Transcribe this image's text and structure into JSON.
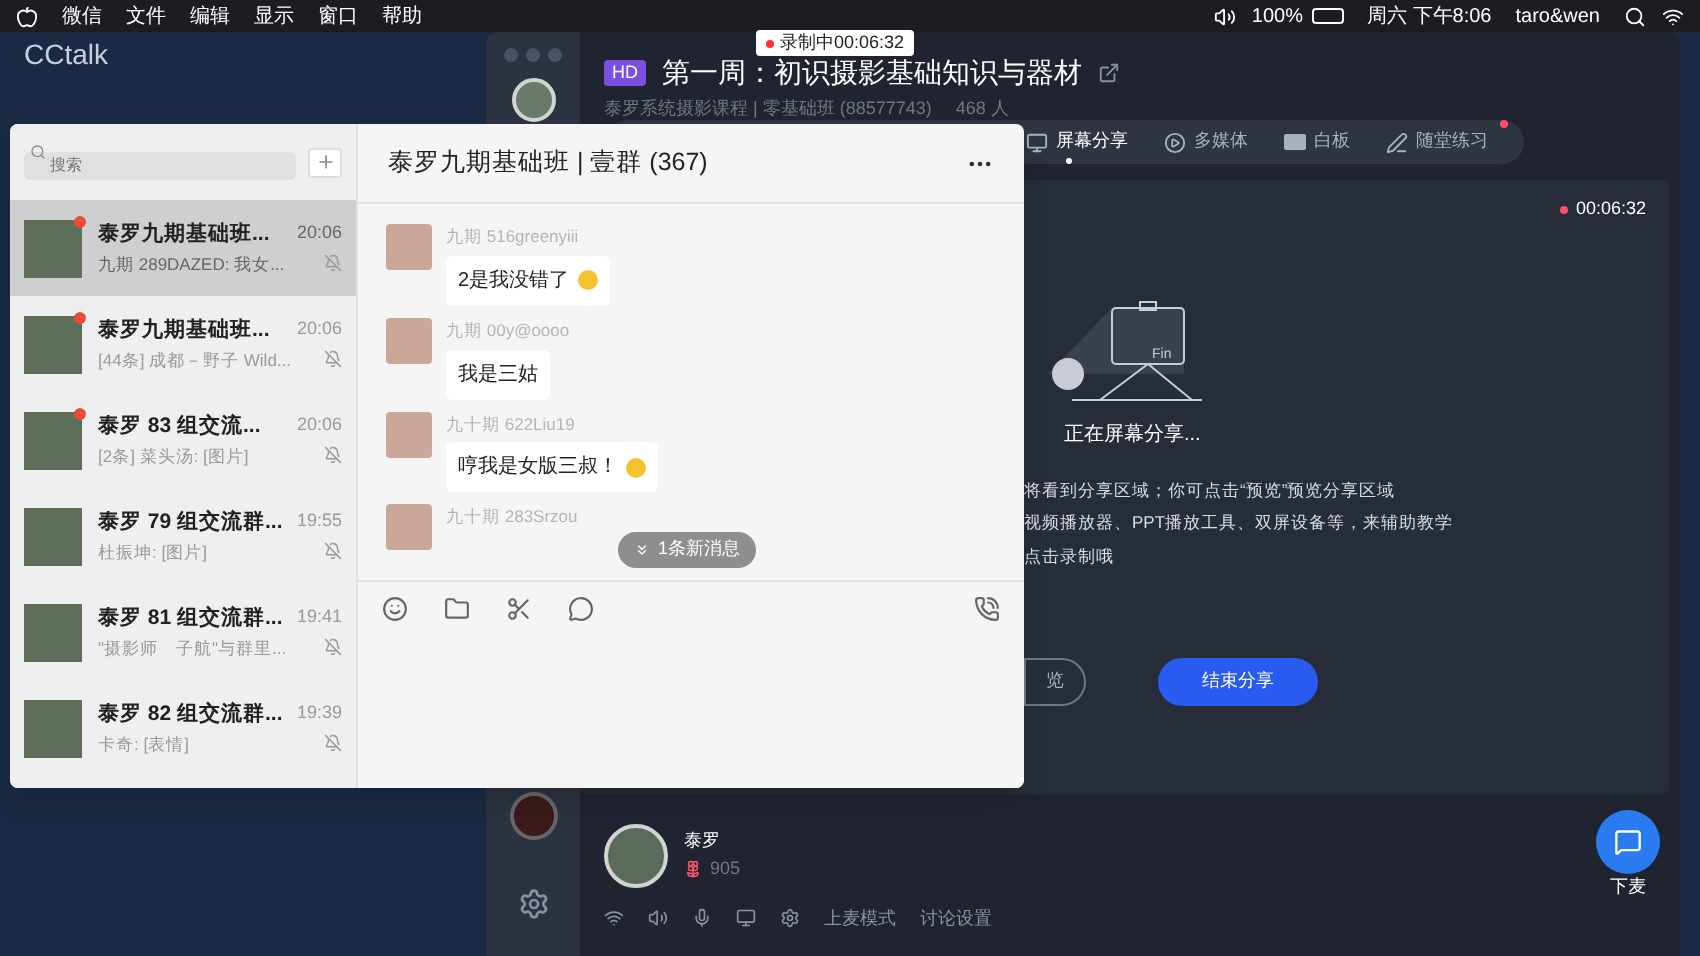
{
  "menubar": {
    "app_menus": [
      "微信",
      "文件",
      "编辑",
      "显示",
      "窗口",
      "帮助"
    ],
    "battery": "100%",
    "clock": "周六 下午8:06",
    "user": "taro&wen"
  },
  "desktop_label": "CCtalk",
  "recording_badge": "录制中00:06:32",
  "classroom": {
    "hd_badge": "HD",
    "title": "第一周：初识摄影基础知识与器材",
    "subtitle": "泰罗系统摄影课程 | 零基础班 (88577743)",
    "members": "468 人",
    "tools": [
      {
        "label": "屏幕分享",
        "selected": true,
        "badge": false
      },
      {
        "label": "多媒体",
        "selected": false,
        "badge": false
      },
      {
        "label": "白板",
        "selected": false,
        "badge": false
      },
      {
        "label": "随堂练习",
        "selected": false,
        "badge": true
      }
    ],
    "projector_label": "Fin",
    "timer": "00:06:32",
    "status": "正在屏幕分享...",
    "tips": [
      "将看到分享区域；你可点击“预览”预览分享区域",
      "视频播放器、PPT播放工具、双屏设备等，来辅助教学",
      "点击录制哦"
    ],
    "buttons": [
      {
        "label": "览",
        "kind": "outline"
      },
      {
        "label": "结束分享",
        "kind": "primary"
      }
    ],
    "speaker": {
      "name": "泰罗",
      "flowers": "905"
    },
    "mic_button": "下麦",
    "footer_items": [
      "上麦模式",
      "讨论设置"
    ]
  },
  "wechat": {
    "search": {
      "placeholder": "搜索"
    },
    "chats": [
      {
        "name": "泰罗九期基础班...",
        "time": "20:06",
        "preview": "九期 289DAZED: 我女...",
        "unread": true,
        "selected": true
      },
      {
        "name": "泰罗九期基础班...",
        "time": "20:06",
        "preview": "[44条] 成都－野子 Wild...",
        "unread": true,
        "selected": false
      },
      {
        "name": "泰罗 83 组交流...",
        "time": "20:06",
        "preview": "[2条] 菜头汤: [图片]",
        "unread": true,
        "selected": false
      },
      {
        "name": "泰罗 79 组交流群...",
        "time": "19:55",
        "preview": "杜振坤: [图片]",
        "unread": false,
        "selected": false
      },
      {
        "name": "泰罗 81 组交流群...",
        "time": "19:41",
        "preview": "\"摄影师　子航\"与群里...",
        "unread": false,
        "selected": false
      },
      {
        "name": "泰罗 82 组交流群...",
        "time": "19:39",
        "preview": "卡奇: [表情]",
        "unread": false,
        "selected": false
      }
    ],
    "chat": {
      "title": "泰罗九期基础班 | 壹群 (367)",
      "messages": [
        {
          "sender": "九期 516greenyiii",
          "text": "2是我没错了",
          "emoji": true
        },
        {
          "sender": "九期 00y@oooo",
          "text": "我是三姑",
          "emoji": false
        },
        {
          "sender": "九十期 622Liu19",
          "text": "哼我是女版三叔！",
          "emoji": true
        },
        {
          "sender": "九十期 283Srzou"
        }
      ],
      "new_messages": "1条新消息"
    }
  }
}
